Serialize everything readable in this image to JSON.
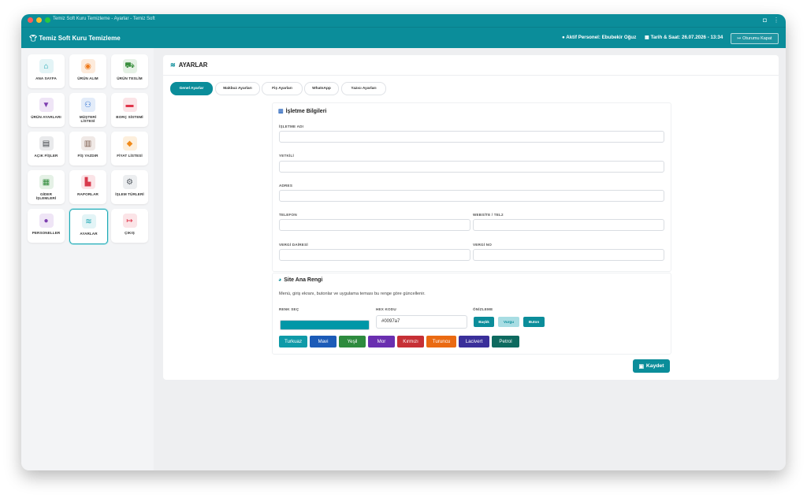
{
  "window": {
    "title": "Temiz Soft Kuru Temizleme - Ayarlar - Temiz Soft"
  },
  "appbar": {
    "brand": "Temiz Soft Kuru Temizleme",
    "personel": "Aktif Personel: Ebubekir Oğuz",
    "datetime": "Tarih & Saat: 26.07.2026 - 13:34",
    "logout": "Oturumu Kapat"
  },
  "sidebar": {
    "items": [
      {
        "label": "ANA SAYFA",
        "icon": "home-icon",
        "color": "#14a3b0",
        "bg": "#e3f4f6"
      },
      {
        "label": "ÜRÜN ALIM",
        "icon": "record-icon",
        "color": "#f07a1a",
        "bg": "#fdebdc"
      },
      {
        "label": "ÜRÜN TESLİM",
        "icon": "delivery-icon",
        "color": "#3a8f3e",
        "bg": "#e5f1e5"
      },
      {
        "label": "ÜRÜN AYARLARI",
        "icon": "shirt-icon",
        "color": "#7e3fb0",
        "bg": "#efe5f6"
      },
      {
        "label": "MÜŞTERİ LİSTESİ",
        "icon": "users-icon",
        "color": "#2b6fd1",
        "bg": "#e3ecf9"
      },
      {
        "label": "BORÇ SİSTEMİ",
        "icon": "wallet-icon",
        "color": "#e0354a",
        "bg": "#fbe4e7"
      },
      {
        "label": "AÇIK FİŞLER",
        "icon": "file-icon",
        "color": "#3b3f44",
        "bg": "#e9eaec"
      },
      {
        "label": "FİŞ YAZDIR",
        "icon": "barcode-icon",
        "color": "#7a5a4a",
        "bg": "#f0e9e6"
      },
      {
        "label": "FİYAT LİSTESİ",
        "icon": "tag-icon",
        "color": "#f08a1a",
        "bg": "#fdefdc"
      },
      {
        "label": "GİDER İŞLEMLERİ",
        "icon": "money-icon",
        "color": "#2f8a3a",
        "bg": "#e5f1e6"
      },
      {
        "label": "RAPORLAR",
        "icon": "chart-icon",
        "color": "#d83a4c",
        "bg": "#fbe4e7"
      },
      {
        "label": "İŞLEM TÜRLERİ",
        "icon": "gears-icon",
        "color": "#555b62",
        "bg": "#eceef0"
      },
      {
        "label": "PERSONELLER",
        "icon": "user-icon",
        "color": "#7e3fb0",
        "bg": "#efe5f6"
      },
      {
        "label": "AYARLAR",
        "icon": "sliders-icon",
        "color": "#14a3b0",
        "bg": "#e3f4f6"
      },
      {
        "label": "ÇIKIŞ",
        "icon": "logout-icon",
        "color": "#e0354a",
        "bg": "#fbe4e7"
      }
    ]
  },
  "page": {
    "title": "AYARLAR"
  },
  "tabs": [
    "Genel Ayarlar",
    "Makbuz Ayarları",
    "Fiş Ayarları",
    "WhatsApp",
    "Yazıcı Ayarları"
  ],
  "business": {
    "title": "İşletme Bilgileri",
    "fields": {
      "name": "İŞLETME ADI",
      "owner": "YETKİLİ",
      "address": "ADRES",
      "phone": "TELEFON",
      "website": "WEBSİTE / TEL2",
      "tax_office": "VERGİ DAİRESİ",
      "tax_no": "VERGİ NO"
    }
  },
  "theme": {
    "title": "Site Ana Rengi",
    "description": "Menü, giriş ekranı, butonlar ve uygulama teması bu renge göre güncellenir.",
    "pick_label": "RENK SEÇ",
    "hex_label": "HEX KODU",
    "hex_value": "#0097a7",
    "preview_label": "ÖNİZLEME",
    "selected_color": "#0097a7",
    "preview": [
      "Başlık",
      "Vurgu",
      "Buton"
    ],
    "colors": [
      {
        "name": "Turkuaz",
        "hex": "#0f9aa8"
      },
      {
        "name": "Mavi",
        "hex": "#1c5bb8"
      },
      {
        "name": "Yeşil",
        "hex": "#2e8b3e"
      },
      {
        "name": "Mor",
        "hex": "#6a2fb0"
      },
      {
        "name": "Kırmızı",
        "hex": "#c62f35"
      },
      {
        "name": "Turuncu",
        "hex": "#ea6a12"
      },
      {
        "name": "Lacivert",
        "hex": "#3a2f9a"
      },
      {
        "name": "Petrol",
        "hex": "#0e6a5f"
      }
    ]
  },
  "save": {
    "label": "Kaydet"
  }
}
